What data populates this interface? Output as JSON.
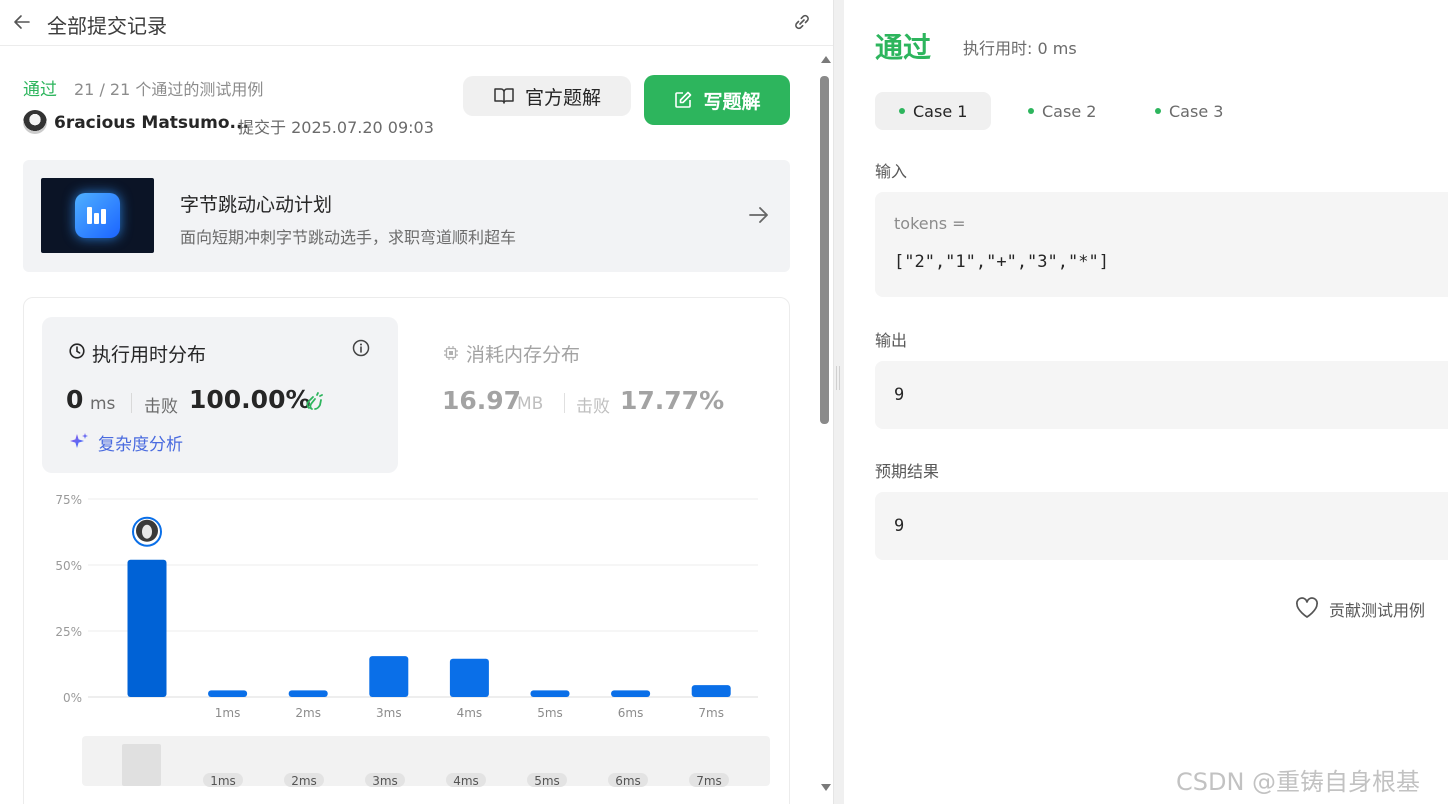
{
  "topbar": {
    "title": "全部提交记录"
  },
  "submission": {
    "status": "通过",
    "passed_text": "21 / 21 个通过的测试用例",
    "username": "6racious Matsumo...",
    "submitted_at": "提交于 2025.07.20 09:03"
  },
  "buttons": {
    "official_solution": "官方题解",
    "write_solution": "写题解"
  },
  "promo": {
    "title": "字节跳动心动计划",
    "subtitle": "面向短期冲刺字节跳动选手，求职弯道顺利超车"
  },
  "runtime": {
    "title": "执行用时分布",
    "value": "0",
    "unit": "ms",
    "beat_label": "击败",
    "beat_value": "100.00%",
    "complexity_link": "复杂度分析"
  },
  "memory": {
    "title": "消耗内存分布",
    "value": "16.97",
    "unit": "MB",
    "beat_label": "击败",
    "beat_value": "17.77%"
  },
  "chart_data": {
    "type": "bar",
    "categories": [
      "",
      "1ms",
      "2ms",
      "3ms",
      "4ms",
      "5ms",
      "6ms",
      "7ms"
    ],
    "values": [
      52,
      2.5,
      2.5,
      15.5,
      14.5,
      2.5,
      2.5,
      4.5
    ],
    "ylim": [
      0,
      75
    ],
    "yticks": [
      "75%",
      "50%",
      "25%",
      "0%"
    ],
    "ytick_values": [
      75,
      50,
      25,
      0
    ],
    "highlight_index": 0,
    "bar_color": "#0a6fe8",
    "bar_color_highlight": "#0062d6",
    "grid": true,
    "minimap_labels": [
      "1ms",
      "2ms",
      "3ms",
      "4ms",
      "5ms",
      "6ms",
      "7ms"
    ]
  },
  "result_panel": {
    "status": "通过",
    "runtime_text": "执行用时: 0 ms",
    "cases": [
      {
        "label": "Case 1",
        "active": true
      },
      {
        "label": "Case 2",
        "active": false
      },
      {
        "label": "Case 3",
        "active": false
      }
    ],
    "input_label": "输入",
    "input_var": "tokens =",
    "input_value": "[\"2\",\"1\",\"+\",\"3\",\"*\"]",
    "output_label": "输出",
    "output_value": "9",
    "expected_label": "预期结果",
    "expected_value": "9",
    "contribute_label": "贡献测试用例"
  },
  "watermark": "CSDN @重铸自身根基",
  "colors": {
    "accent_green": "#2db55d",
    "link_blue": "#4a6bdf",
    "bar_blue": "#0a6fe8"
  }
}
